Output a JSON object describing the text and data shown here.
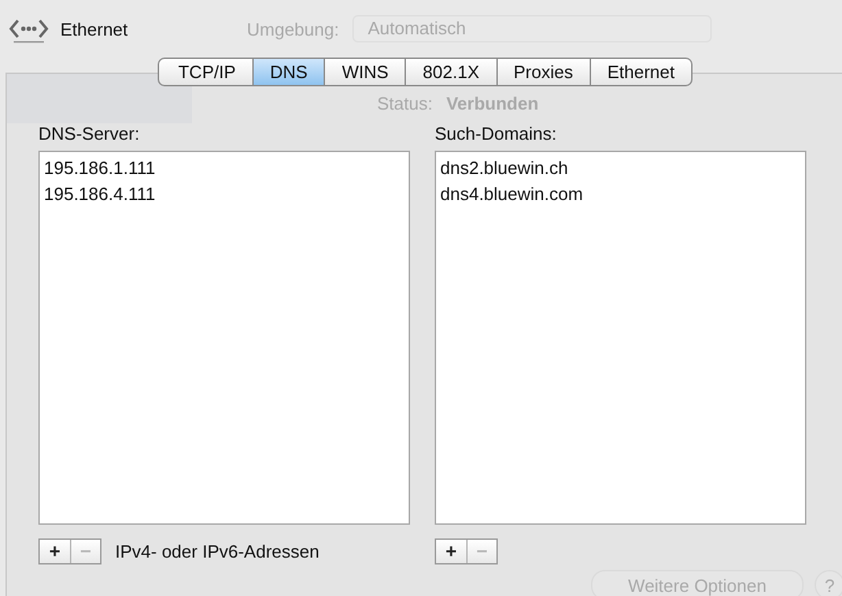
{
  "header": {
    "title": "Ethernet"
  },
  "background": {
    "location_label": "Umgebung:",
    "location_value": "Automatisch",
    "status_label": "Status:",
    "status_value": "Verbunden",
    "more_button": "Weitere Optionen",
    "help_button": "?"
  },
  "tabs": [
    {
      "label": "TCP/IP",
      "selected": false
    },
    {
      "label": "DNS",
      "selected": true
    },
    {
      "label": "WINS",
      "selected": false
    },
    {
      "label": "802.1X",
      "selected": false
    },
    {
      "label": "Proxies",
      "selected": false
    },
    {
      "label": "Ethernet",
      "selected": false
    }
  ],
  "lists": [
    {
      "label": "DNS-Server:",
      "items": [
        "195.186.1.111",
        "195.186.4.111"
      ],
      "buttons": [
        {
          "label": "+",
          "disabled": false
        },
        {
          "label": "−",
          "disabled": true
        }
      ],
      "hint": "IPv4- oder IPv6-Adressen"
    },
    {
      "label": "Such-Domains:",
      "items": [
        "dns2.bluewin.ch",
        "dns4.bluewin.com"
      ],
      "buttons": [
        {
          "label": "+",
          "disabled": false
        },
        {
          "label": "−",
          "disabled": true
        }
      ]
    }
  ]
}
